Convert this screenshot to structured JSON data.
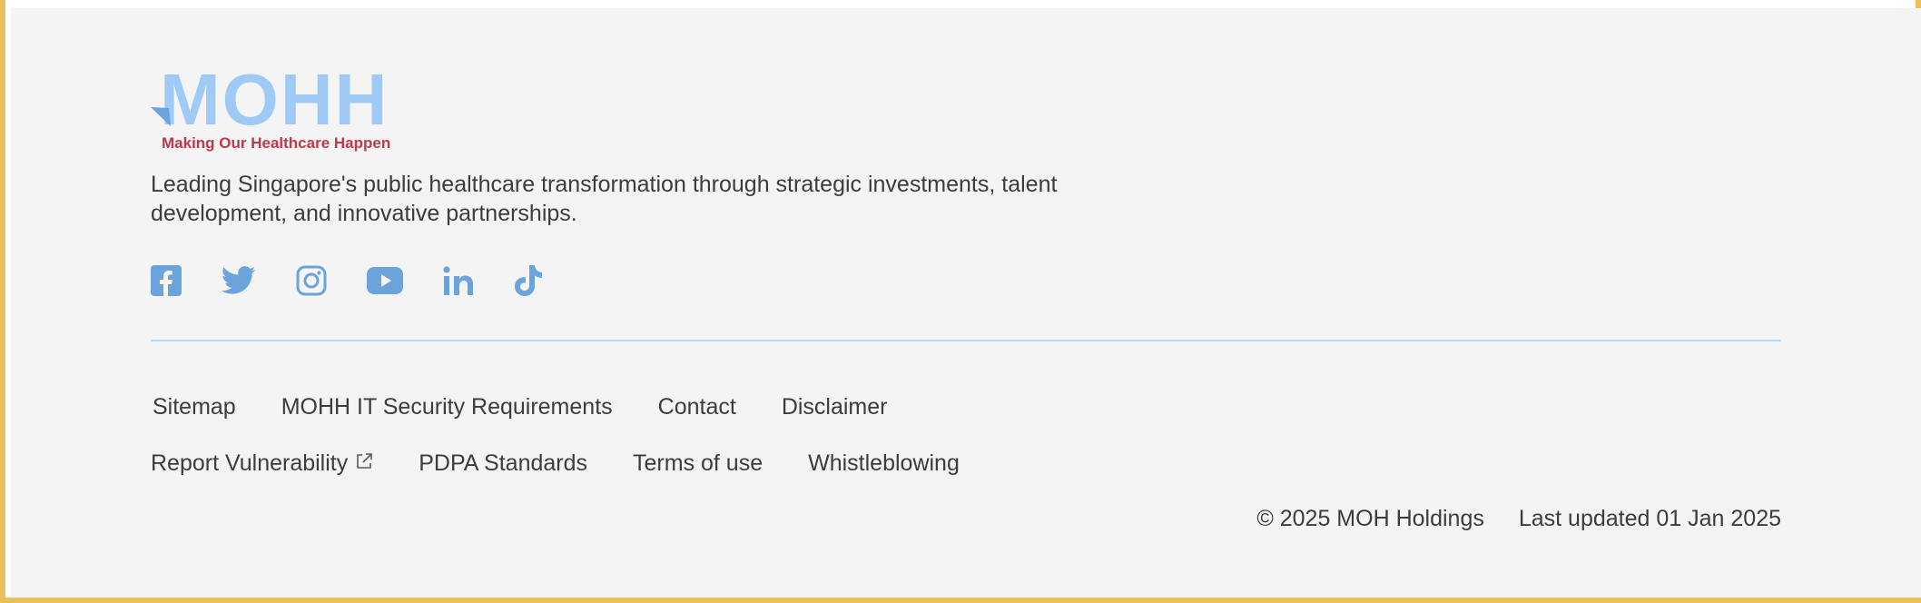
{
  "brand": {
    "name": "MOHH",
    "tagline": "Making Our Healthcare Happen",
    "logo_color": "#9fcaf6",
    "tagline_color": "#c0394b"
  },
  "description": "Leading Singapore's public healthcare transformation through strategic investments, talent development, and innovative partnerships.",
  "social_icons": [
    "facebook-icon",
    "twitter-icon",
    "instagram-icon",
    "youtube-icon",
    "linkedin-icon",
    "tiktok-icon"
  ],
  "social_color": "#6aa4da",
  "links_row1": [
    "Sitemap",
    "MOHH IT Security Requirements",
    "Contact",
    "Disclaimer"
  ],
  "links_row2": [
    "Report Vulnerability",
    "PDPA Standards",
    "Terms of use",
    "Whistleblowing"
  ],
  "copyright": "© 2025 MOH Holdings",
  "last_updated": "Last updated 01 Jan 2025"
}
